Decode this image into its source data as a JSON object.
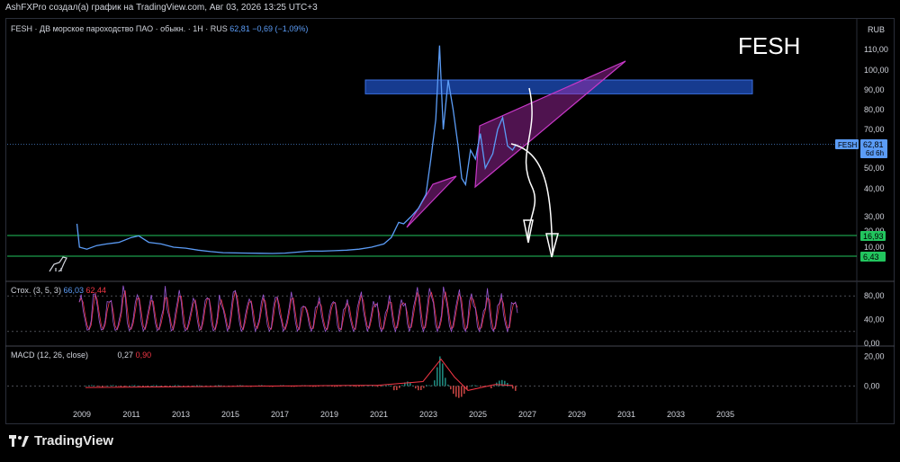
{
  "header": {
    "attribution": "AshFXPro создал(а) график на TradingView.com, Авг 03, 2026 13:25 UTC+3"
  },
  "legend": {
    "main": "FESH · ДВ морское пароходство ПАО · обыкн. · 1H · RUS",
    "last": "62,81",
    "change": "−0,69 (−1,09%)",
    "stoch_label": "Стох. (3, 5, 3)",
    "stoch_k": "66,03",
    "stoch_d": "62,44",
    "macd_label": "MACD (12, 26, close)",
    "macd_v1": "0,27",
    "macd_v2": "0,90"
  },
  "annotation": {
    "symbol_text": "FESH"
  },
  "price_badges": {
    "symbol": "FESH",
    "price": "62,81",
    "countdown": "6d 6h",
    "level_high": "16,93",
    "level_low": "6,43",
    "currency": "RUB"
  },
  "logo": {
    "text": "TradingView"
  },
  "colors": {
    "price_line": "#5b9cf6",
    "accent_green": "#22c55e",
    "zone_blue": "#1e4fbf",
    "triangle": "#b02bb0",
    "stoch_k": "#5b9cf6",
    "stoch_d": "#f23645"
  },
  "chart_data": [
    {
      "type": "line",
      "title": "",
      "x_ticks": [
        "2009",
        "2011",
        "2013",
        "2015",
        "2017",
        "2019",
        "2021",
        "2023",
        "2025",
        "2027",
        "2029",
        "2031",
        "2033",
        "2035"
      ],
      "y_ticks": [
        "110,00",
        "100,00",
        "90,00",
        "80,00",
        "70,00",
        "60,00",
        "50,00",
        "40,00",
        "30,00",
        "20,00",
        "10,00",
        "0,00"
      ],
      "ylim": [
        0,
        115
      ],
      "log_scale": true,
      "series": [
        {
          "points": [
            [
              2008.8,
              25
            ],
            [
              2008.9,
              10
            ],
            [
              2009.2,
              8
            ],
            [
              2009.6,
              11
            ],
            [
              2010.0,
              12
            ],
            [
              2010.5,
              13
            ],
            [
              2011.0,
              16
            ],
            [
              2011.3,
              17
            ],
            [
              2011.7,
              13
            ],
            [
              2012.2,
              12
            ],
            [
              2012.7,
              10
            ],
            [
              2013.2,
              9
            ],
            [
              2013.7,
              7
            ],
            [
              2014.2,
              5.5
            ],
            [
              2014.7,
              4.5
            ],
            [
              2015.2,
              4.2
            ],
            [
              2015.7,
              4
            ],
            [
              2016.2,
              3.8
            ],
            [
              2016.7,
              3.6
            ],
            [
              2017.2,
              4
            ],
            [
              2017.7,
              5
            ],
            [
              2018.2,
              6
            ],
            [
              2018.7,
              6
            ],
            [
              2019.2,
              6.5
            ],
            [
              2019.7,
              7
            ],
            [
              2020.2,
              8
            ],
            [
              2020.7,
              10
            ],
            [
              2021.2,
              12
            ],
            [
              2021.5,
              16
            ],
            [
              2021.8,
              26
            ],
            [
              2022.0,
              25
            ],
            [
              2022.3,
              30
            ],
            [
              2022.6,
              33
            ],
            [
              2022.9,
              38
            ],
            [
              2023.1,
              55
            ],
            [
              2023.3,
              75
            ],
            [
              2023.45,
              112
            ],
            [
              2023.6,
              70
            ],
            [
              2023.8,
              95
            ],
            [
              2024.0,
              80
            ],
            [
              2024.2,
              62
            ],
            [
              2024.35,
              45
            ],
            [
              2024.5,
              42
            ],
            [
              2024.7,
              60
            ],
            [
              2024.9,
              55
            ],
            [
              2025.1,
              68
            ],
            [
              2025.3,
              50
            ],
            [
              2025.6,
              58
            ],
            [
              2025.8,
              70
            ],
            [
              2026.0,
              76
            ],
            [
              2026.2,
              62
            ],
            [
              2026.4,
              60
            ],
            [
              2026.55,
              62.81
            ]
          ]
        }
      ],
      "horizontal_levels": [
        16.93,
        6.43
      ],
      "zone": {
        "x": [
          2020.3,
          2035.7
        ],
        "y": [
          88,
          95
        ]
      }
    },
    {
      "type": "line",
      "title": "Стох. (3, 5, 3)",
      "y_ticks": [
        "80,00",
        "40,00",
        "0,00"
      ],
      "ylim": [
        0,
        100
      ],
      "series": [
        {
          "name": "K",
          "value_last": 66.03
        },
        {
          "name": "D",
          "value_last": 62.44
        }
      ]
    },
    {
      "type": "bar",
      "title": "MACD (12, 26, close)",
      "y_ticks": [
        "20,00",
        "0,00"
      ],
      "ylim": [
        -10,
        25
      ],
      "values_last": [
        0.27,
        0.9
      ]
    }
  ]
}
